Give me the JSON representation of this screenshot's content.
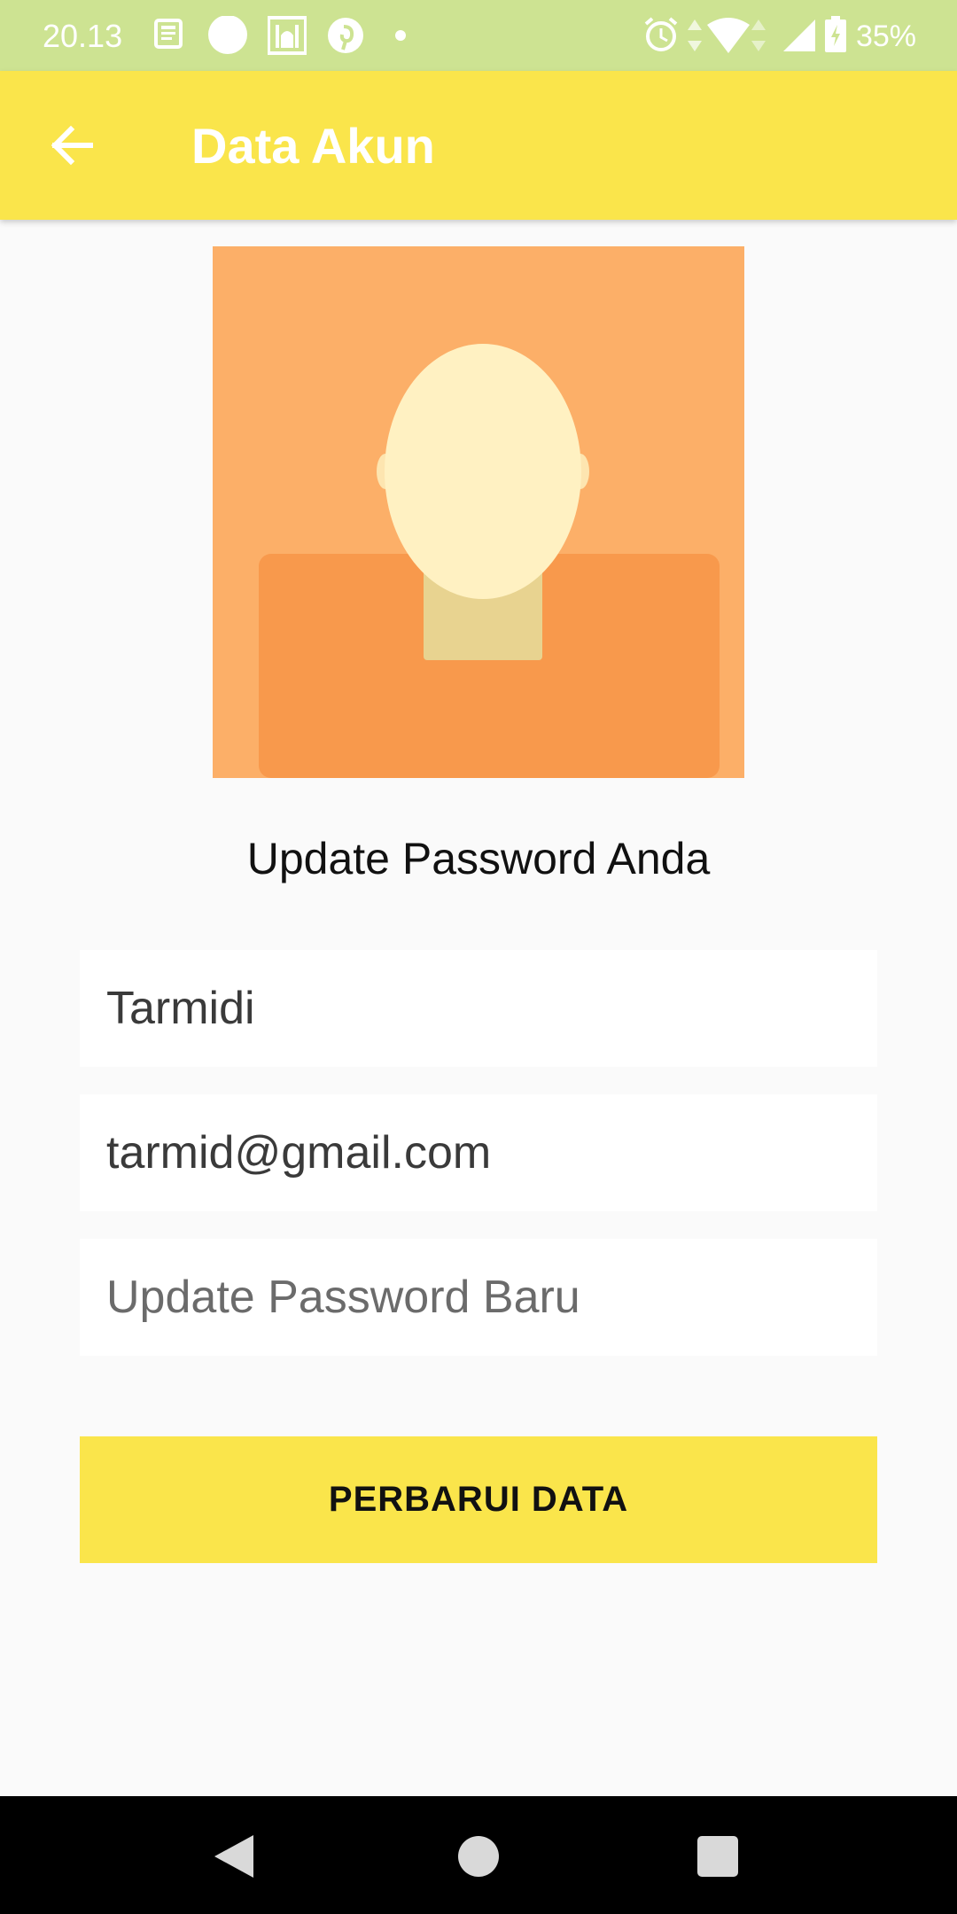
{
  "status_bar": {
    "time": "20.13",
    "battery": "35%",
    "icons": [
      "news-icon",
      "circle-icon",
      "mosque-icon",
      "pinterest-icon",
      "dot-icon",
      "alarm-icon",
      "wifi-icon",
      "signal-icon",
      "battery-icon"
    ]
  },
  "app_bar": {
    "title": "Data Akun",
    "back_icon": "arrow-back-icon"
  },
  "avatar": {
    "icon": "default-person-avatar",
    "colors": {
      "background": "#fcaf68",
      "shirt": "#f8994c",
      "face": "#fff1c2",
      "neck": "#e8d390"
    }
  },
  "form": {
    "heading": "Update Password Anda",
    "name_value": "Tarmidi",
    "email_value": "tarmid@gmail.com",
    "password_placeholder": "Update Password Baru",
    "password_value": "",
    "submit_label": "PERBARUI DATA"
  },
  "nav_bar": {
    "icons": [
      "back-triangle-icon",
      "home-circle-icon",
      "recents-square-icon"
    ]
  },
  "colors": {
    "status_bar": "#cde392",
    "accent": "#fae54b",
    "background": "#fafafa",
    "nav_bar": "#000000"
  }
}
